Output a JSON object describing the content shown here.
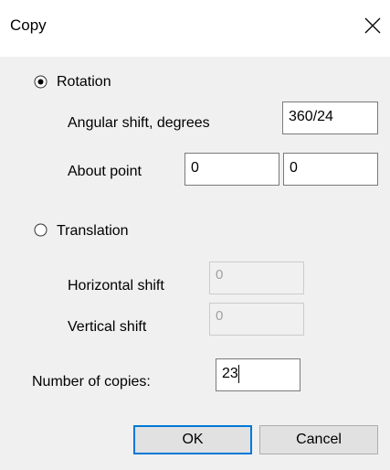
{
  "window": {
    "title": "Copy",
    "close_icon": "close-x-icon"
  },
  "rotation": {
    "label": "Rotation",
    "selected": true,
    "angular_shift_label": "Angular shift, degrees",
    "angular_shift_value": "360/24",
    "about_point_label": "About point",
    "about_point_x": "0",
    "about_point_y": "0"
  },
  "translation": {
    "label": "Translation",
    "selected": false,
    "horizontal_shift_label": "Horizontal shift",
    "horizontal_shift_value": "0",
    "vertical_shift_label": "Vertical shift",
    "vertical_shift_value": "0"
  },
  "copies": {
    "label": "Number of copies:",
    "value": "23"
  },
  "buttons": {
    "ok": "OK",
    "cancel": "Cancel"
  },
  "colors": {
    "dialog_background": "#f0f0f0",
    "titlebar_background": "#ffffff",
    "focus_border": "#0078d7"
  }
}
